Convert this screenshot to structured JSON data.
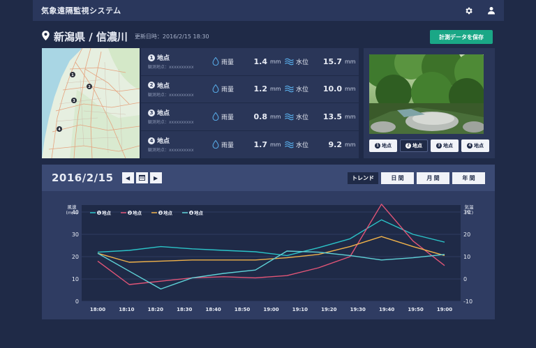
{
  "app": {
    "title": "気象遠隔監視システム"
  },
  "location": {
    "name": "新潟県 / 信濃川",
    "updated": "更新日時：2016/2/15 18:30"
  },
  "save_label": "計測データを保存",
  "stations": [
    {
      "num": "1",
      "name": "地点",
      "sub": "観測地点：xxxxxxxxxx",
      "rain_label": "雨量",
      "rain": "1.4",
      "rain_unit": "mm",
      "level_label": "水位",
      "level": "15.7",
      "level_unit": "mm"
    },
    {
      "num": "2",
      "name": "地点",
      "sub": "観測地点：xxxxxxxxxx",
      "rain_label": "雨量",
      "rain": "1.2",
      "rain_unit": "mm",
      "level_label": "水位",
      "level": "10.0",
      "level_unit": "mm"
    },
    {
      "num": "3",
      "name": "地点",
      "sub": "観測地点：xxxxxxxxxx",
      "rain_label": "雨量",
      "rain": "0.8",
      "rain_unit": "mm",
      "level_label": "水位",
      "level": "13.5",
      "level_unit": "mm"
    },
    {
      "num": "4",
      "name": "地点",
      "sub": "観測地点：xxxxxxxxxx",
      "rain_label": "雨量",
      "rain": "1.7",
      "rain_unit": "mm",
      "level_label": "水位",
      "level": "9.2",
      "level_unit": "mm"
    }
  ],
  "map": {
    "markers": [
      "1",
      "2",
      "3",
      "4"
    ]
  },
  "photo_buttons": [
    {
      "num": "1",
      "label": "地点",
      "active": false
    },
    {
      "num": "2",
      "label": "地点",
      "active": true
    },
    {
      "num": "3",
      "label": "地点",
      "active": false
    },
    {
      "num": "4",
      "label": "地点",
      "active": false
    }
  ],
  "chart_header": {
    "date": "2016/2/15",
    "trend_label": "トレンド",
    "day_label": "日 間",
    "month_label": "月 間",
    "year_label": "年 間"
  },
  "chart_data": {
    "type": "line",
    "x": [
      "18:00",
      "18:10",
      "18:20",
      "18:30",
      "18:40",
      "18:50",
      "19:00",
      "19:10",
      "19:20",
      "19:30",
      "19:40",
      "19:50",
      "19:00"
    ],
    "left_axis": {
      "label_line1": "風速",
      "label_line2": "(m/s)",
      "ticks": [
        0,
        10,
        20,
        30,
        40
      ],
      "range": [
        0,
        40
      ]
    },
    "right_axis": {
      "label_line1": "気温",
      "label_line2": "(℃)",
      "ticks": [
        -10,
        0,
        10,
        20,
        30
      ],
      "range": [
        -10,
        30
      ]
    },
    "series": [
      {
        "name": "地点",
        "num": "1",
        "color": "#2bc4c8",
        "values": [
          22,
          22.8,
          24.5,
          23.5,
          22.8,
          22.2,
          20.5,
          24,
          28,
          36.5,
          30,
          26.5
        ]
      },
      {
        "name": "地点",
        "num": "2",
        "color": "#e25577",
        "values": [
          18,
          7.5,
          9,
          10.5,
          11,
          10.5,
          11.5,
          15,
          20,
          43.5,
          27,
          16
        ]
      },
      {
        "name": "地点",
        "num": "3",
        "color": "#f0b24a",
        "values": [
          21.5,
          17.5,
          18,
          18.5,
          18.5,
          18.5,
          19.5,
          21,
          24.5,
          29,
          24.5,
          20.5
        ]
      },
      {
        "name": "地点",
        "num": "4",
        "color": "#5fd3d8",
        "values": [
          21.5,
          13.5,
          5.5,
          10.5,
          12.5,
          14,
          22.5,
          22,
          20.5,
          18.5,
          19.5,
          21
        ]
      }
    ],
    "grid": true,
    "legend": "top-left"
  }
}
